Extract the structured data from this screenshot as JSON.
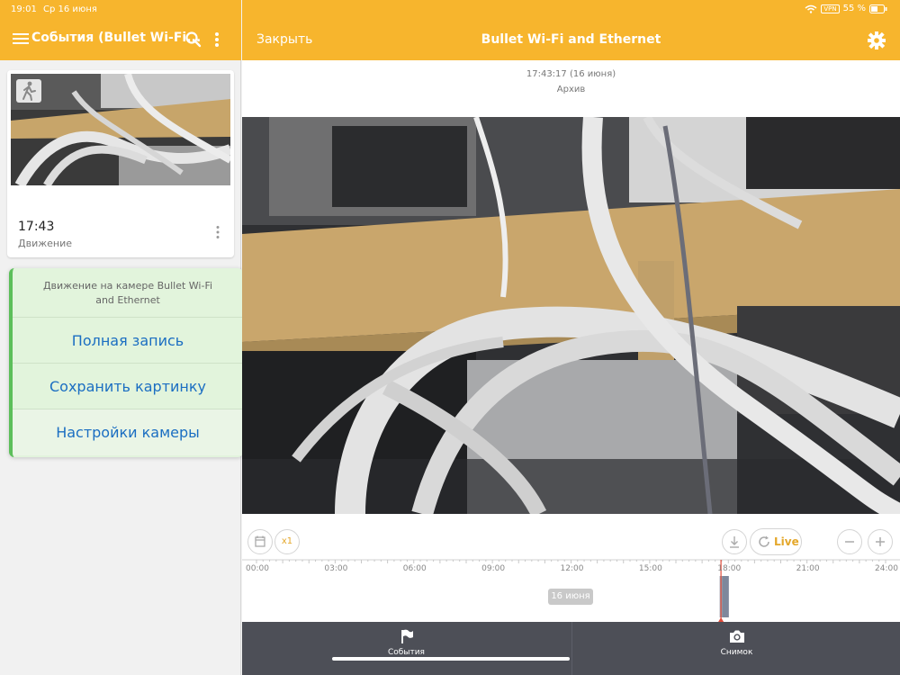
{
  "status": {
    "time": "19:01",
    "date": "Ср 16 июня",
    "vpn": "VPN",
    "battery": "55 %"
  },
  "left_header": {
    "title": "События (Bullet Wi-Fi..."
  },
  "event": {
    "time": "17:43",
    "type": "Движение"
  },
  "popup": {
    "header": "Движение на камере Bullet Wi-Fi and Ethernet",
    "actions": [
      "Полная запись",
      "Сохранить картинку",
      "Настройки камеры"
    ]
  },
  "right_header": {
    "close": "Закрыть",
    "title": "Bullet Wi-Fi and Ethernet"
  },
  "playback": {
    "timestamp": "17:43:17 (16 июня)",
    "mode": "Архив"
  },
  "controls": {
    "speed": "x1",
    "live": "Live"
  },
  "timeline": {
    "labels": [
      "00:00",
      "03:00",
      "06:00",
      "09:00",
      "12:00",
      "15:00",
      "18:00",
      "21:00",
      "24:00"
    ],
    "date_chip": "16 июня",
    "playhead_hours": 17.72
  },
  "bottom_nav": {
    "events": "События",
    "snapshot": "Снимок"
  },
  "colors": {
    "accent": "#f7b52d",
    "bar": "#4d4f57",
    "link": "#1b6ec2",
    "popup_bg": "#e2f4dc"
  }
}
